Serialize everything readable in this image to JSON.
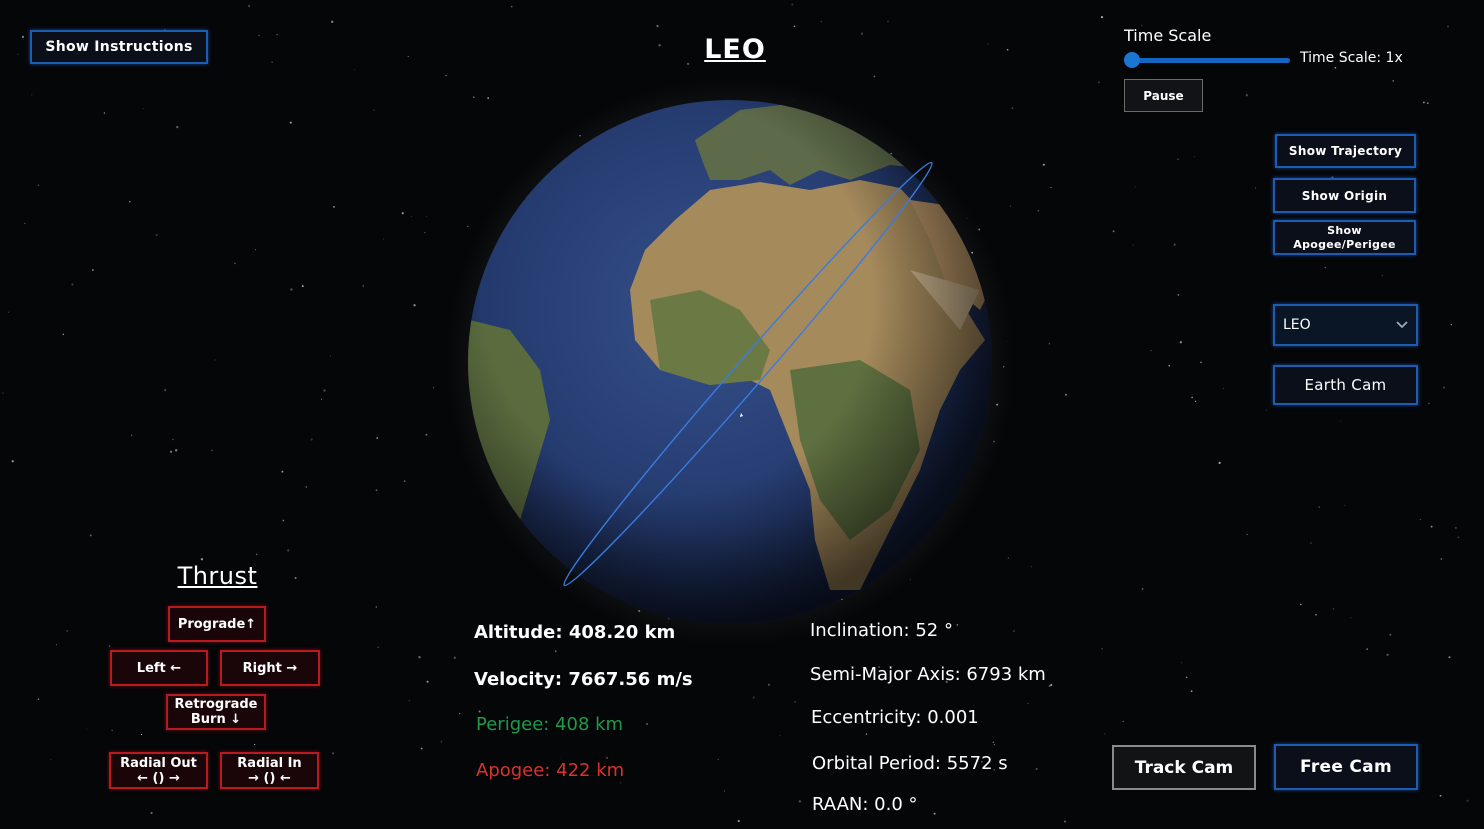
{
  "title": "LEO",
  "instructions_button": "Show Instructions",
  "time_scale": {
    "heading": "Time Scale",
    "readout": "Time Scale: 1x",
    "value_fraction": 0.0,
    "pause_label": "Pause"
  },
  "toggles": {
    "trajectory": "Show Trajectory",
    "origin": "Show Origin",
    "apogee_perigee_line1": "Show",
    "apogee_perigee_line2": "Apogee/Perigee"
  },
  "orbit_select": {
    "value": "LEO"
  },
  "cameras": {
    "earth": "Earth Cam",
    "track": "Track Cam",
    "free": "Free Cam"
  },
  "thrust": {
    "heading": "Thrust",
    "prograde": "Prograde↑",
    "left": "Left ←",
    "right": "Right →",
    "retrograde_line1": "Retrograde",
    "retrograde_line2": "Burn ↓",
    "radial_out_line1": "Radial Out",
    "radial_out_line2": "← () →",
    "radial_in_line1": "Radial In",
    "radial_in_line2": "→ () ←"
  },
  "stats": {
    "altitude": "Altitude: 408.20 km",
    "velocity": "Velocity: 7667.56 m/s",
    "perigee": "Perigee: 408 km",
    "apogee": "Apogee: 422 km",
    "inclination": "Inclination: 52 °",
    "semi_major_axis": "Semi-Major Axis: 6793 km",
    "eccentricity": "Eccentricity: 0.001",
    "orbital_period": "Orbital Period: 5572 s",
    "raan": "RAAN: 0.0 °"
  },
  "colors": {
    "accent_blue": "#1a5db3",
    "thrust_red": "#b81a1f",
    "perigee_green": "#1f9a4a",
    "apogee_red": "#d8342c",
    "orbit_line": "#3a7be0"
  }
}
